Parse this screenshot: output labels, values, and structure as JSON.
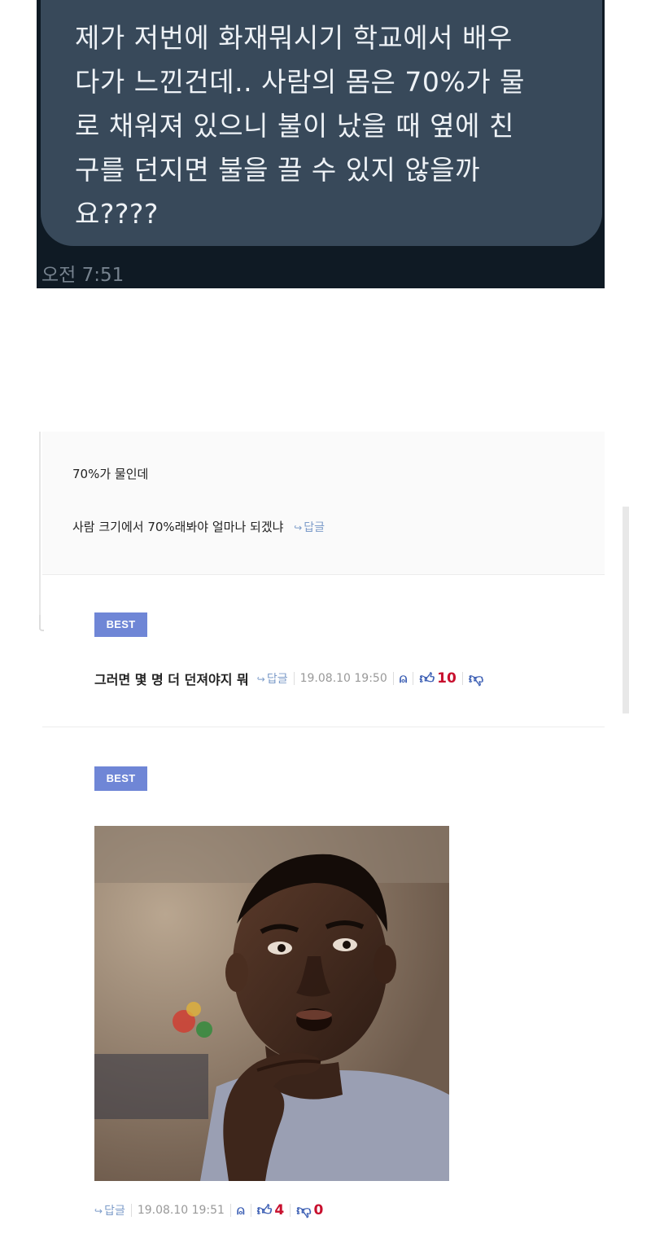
{
  "chat": {
    "message": "제가 저번에 화재뭐시기 학교에서 배우\n다가 느낀건데.. 사람의 몸은 70%가 물\n로 채워져 있으니 불이 났을 때 옆에 친\n구를 던지면 불을 끌 수 있지 않을까\n요????",
    "time": "오전 7:51"
  },
  "parent_comment": {
    "line1": "70%가 물인데",
    "line2": "사람 크기에서 70%래봐야 얼마나 되겠냐",
    "reply_label": "답글"
  },
  "comments": [
    {
      "badge": "BEST",
      "text": "그러면 몇 명 더 던져야지 뭐",
      "reply_label": "답글",
      "timestamp": "19.08.10 19:50",
      "likes": "10"
    },
    {
      "badge": "BEST",
      "reply_label": "답글",
      "timestamp": "19.08.10 19:51",
      "likes": "4",
      "dislikes": "0"
    }
  ],
  "icons": {
    "reply_arrow": "reply-arrow-icon",
    "bell": "bell-icon",
    "thumb_up": "thumbs-up-icon",
    "thumb_down": "thumbs-down-icon"
  },
  "colors": {
    "chat_bg": "#0f1a24",
    "bubble": "#38495a",
    "badge": "#6f86d6",
    "vote": "#c8102e",
    "link": "#7d9cc9"
  }
}
